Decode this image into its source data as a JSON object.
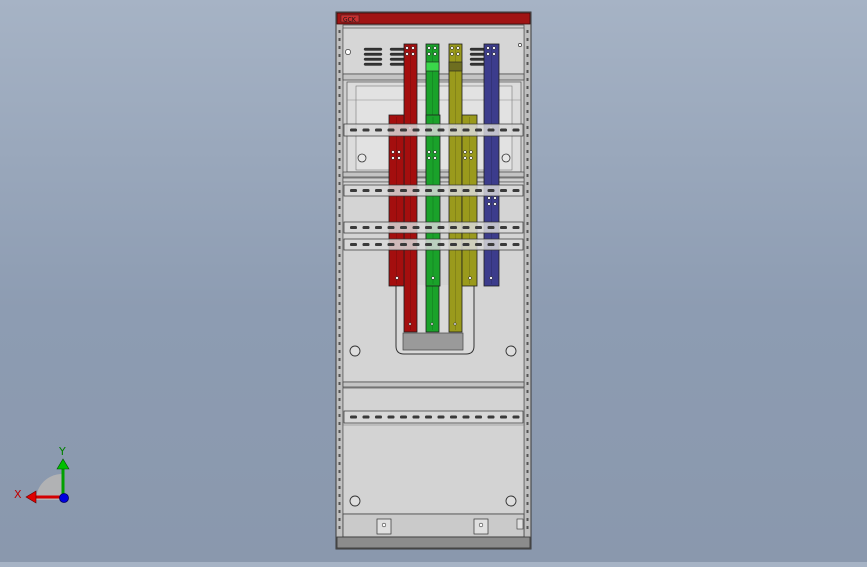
{
  "cabinet": {
    "nameplate_text": "GCK"
  },
  "triad": {
    "x_label": "X",
    "y_label": "Y",
    "x_color": "#d40000",
    "y_color": "#00a000",
    "z_color": "#0000ff"
  },
  "busbar_colors": {
    "phase_a": "#a40e0e",
    "phase_b": "#1aa22a",
    "phase_c": "#9a9a1c",
    "neutral": "#3c3c8c"
  },
  "colors": {
    "frame": "#bcbcbc",
    "panel": "#d2d2d2",
    "header": "#a01414",
    "background_top": "#a6b3c5",
    "background_bottom": "#8a98ad"
  }
}
